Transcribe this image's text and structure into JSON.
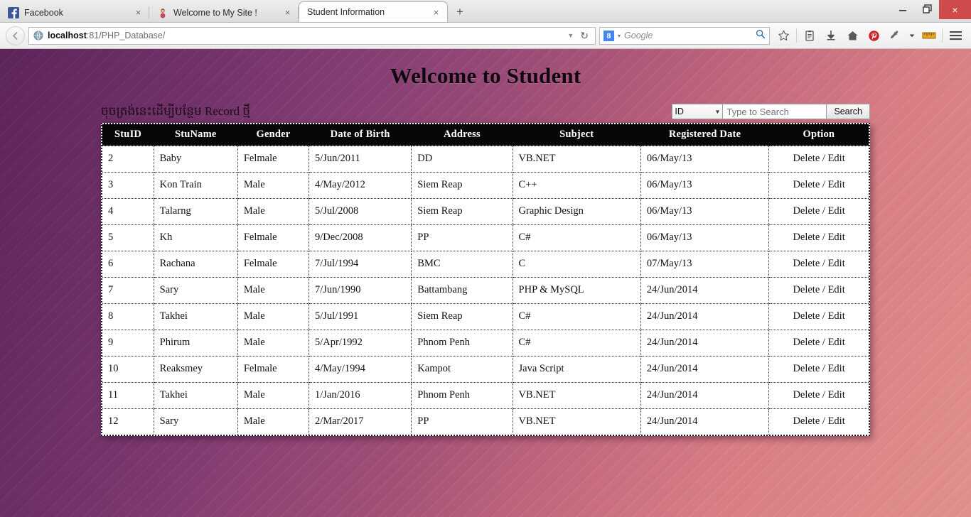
{
  "browser": {
    "tabs": [
      {
        "title": "Facebook",
        "favicon": "facebook-icon",
        "active": false
      },
      {
        "title": "Welcome to My Site !",
        "favicon": "site-icon",
        "active": false
      },
      {
        "title": "Student Information",
        "favicon": "",
        "active": true
      }
    ],
    "new_tab_label": "+",
    "close_label": "×",
    "window_controls": {
      "minimize": "–",
      "restore": "❐",
      "close": "×"
    },
    "nav": {
      "back_label": "←",
      "url_host": "localhost",
      "url_rest": ":81/PHP_Database/",
      "url_dropdown": "▼",
      "reload": "↻"
    },
    "search": {
      "engine": "Google",
      "engine_initial": "8",
      "dropdown": "▾",
      "placeholder": "Google",
      "magnifier": "⌕"
    },
    "toolbar_icons": [
      "bookmark-star-icon",
      "reading-list-icon",
      "download-icon",
      "home-icon",
      "pinterest-icon",
      "eyedropper-icon",
      "eyedropper-dropdown-icon",
      "ruler-icon",
      "menu-icon"
    ]
  },
  "page": {
    "title": "Welcome to Student",
    "add_record_link": "ចុចត្រង់នេះដើម្បីបន្ថែម Record ថ្មី",
    "search": {
      "field_selected": "ID",
      "field_options": [
        "ID"
      ],
      "input_placeholder": "Type to Search",
      "input_value": "",
      "button_label": "Search"
    },
    "table": {
      "columns": [
        "StuID",
        "StuName",
        "Gender",
        "Date of Birth",
        "Address",
        "Subject",
        "Registered Date",
        "Option"
      ],
      "option_delete": "Delete",
      "option_sep": " / ",
      "option_edit": "Edit",
      "rows": [
        {
          "stuid": "2",
          "name": "Baby",
          "gender": "Felmale",
          "dob": "5/Jun/2011",
          "address": "DD",
          "subject": "VB.NET",
          "registered": "06/May/13"
        },
        {
          "stuid": "3",
          "name": "Kon Train",
          "gender": "Male",
          "dob": "4/May/2012",
          "address": "Siem Reap",
          "subject": "C++",
          "registered": "06/May/13"
        },
        {
          "stuid": "4",
          "name": "Talarng",
          "gender": "Male",
          "dob": "5/Jul/2008",
          "address": "Siem Reap",
          "subject": "Graphic Design",
          "registered": "06/May/13"
        },
        {
          "stuid": "5",
          "name": "Kh",
          "gender": "Felmale",
          "dob": "9/Dec/2008",
          "address": "PP",
          "subject": "C#",
          "registered": "06/May/13"
        },
        {
          "stuid": "6",
          "name": "Rachana",
          "gender": "Felmale",
          "dob": "7/Jul/1994",
          "address": "BMC",
          "subject": "C",
          "registered": "07/May/13"
        },
        {
          "stuid": "7",
          "name": "Sary",
          "gender": "Male",
          "dob": "7/Jun/1990",
          "address": "Battambang",
          "subject": "PHP & MySQL",
          "registered": "24/Jun/2014"
        },
        {
          "stuid": "8",
          "name": "Takhei",
          "gender": "Male",
          "dob": "5/Jul/1991",
          "address": "Siem Reap",
          "subject": "C#",
          "registered": "24/Jun/2014"
        },
        {
          "stuid": "9",
          "name": "Phirum",
          "gender": "Male",
          "dob": "5/Apr/1992",
          "address": "Phnom Penh",
          "subject": "C#",
          "registered": "24/Jun/2014"
        },
        {
          "stuid": "10",
          "name": "Reaksmey",
          "gender": "Felmale",
          "dob": "4/May/1994",
          "address": "Kampot",
          "subject": "Java Script",
          "registered": "24/Jun/2014"
        },
        {
          "stuid": "11",
          "name": "Takhei",
          "gender": "Male",
          "dob": "1/Jan/2016",
          "address": "Phnom Penh",
          "subject": "VB.NET",
          "registered": "24/Jun/2014"
        },
        {
          "stuid": "12",
          "name": "Sary",
          "gender": "Male",
          "dob": "2/Mar/2017",
          "address": "PP",
          "subject": "VB.NET",
          "registered": "24/Jun/2014"
        }
      ]
    }
  },
  "colors": {
    "header_bg": "#070707",
    "page_gradient_start": "#6f3069",
    "page_gradient_end": "#e3918e",
    "close_button": "#cf4b4b",
    "pinterest": "#cb2027"
  }
}
